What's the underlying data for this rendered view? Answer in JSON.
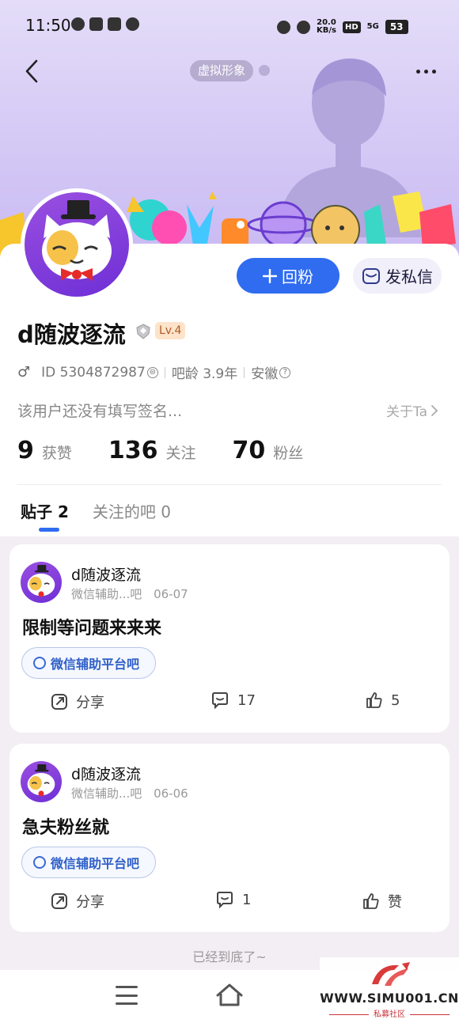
{
  "status_bar": {
    "time": "11:50",
    "net_speed_value": "20.0",
    "net_speed_unit": "KB/s",
    "hd_label": "HD",
    "signal_label": "5G",
    "battery": "53"
  },
  "header": {
    "avatar_chip_label": "虚拟形象"
  },
  "profile": {
    "username": "d随波逐流",
    "level": "Lv.4",
    "gender_symbol": "♂",
    "id_text": "ID 5304872987",
    "bar_age": "吧龄 3.9年",
    "location": "安徽",
    "signature": "该用户还没有填写签名...",
    "about_label": "关于Ta",
    "follow_back_label": "回粉",
    "message_label": "发私信"
  },
  "stats": [
    {
      "num": "9",
      "label": "获赞"
    },
    {
      "num": "136",
      "label": "关注"
    },
    {
      "num": "70",
      "label": "粉丝"
    }
  ],
  "tabs": [
    {
      "label": "贴子 2",
      "active": true
    },
    {
      "label": "关注的吧 0",
      "active": false
    }
  ],
  "posts": [
    {
      "author": "d随波逐流",
      "forum_short": "微信辅助...吧",
      "date": "06-07",
      "title": "限制等问题来来来",
      "forum_tag": "微信辅助平台吧",
      "share_label": "分享",
      "comments": "17",
      "likes": "5"
    },
    {
      "author": "d随波逐流",
      "forum_short": "微信辅助...吧",
      "date": "06-06",
      "title": "急夫粉丝就",
      "forum_tag": "微信辅助平台吧",
      "share_label": "分享",
      "comments": "1",
      "likes": "赞"
    }
  ],
  "end_text": "已经到底了~",
  "watermark": {
    "site": "WWW.SIMU001.CN",
    "sub": "私募社区"
  },
  "colors": {
    "accent": "#2f6cf0",
    "banner_top": "#e4ddf8",
    "level_bg": "#fde3c9"
  }
}
